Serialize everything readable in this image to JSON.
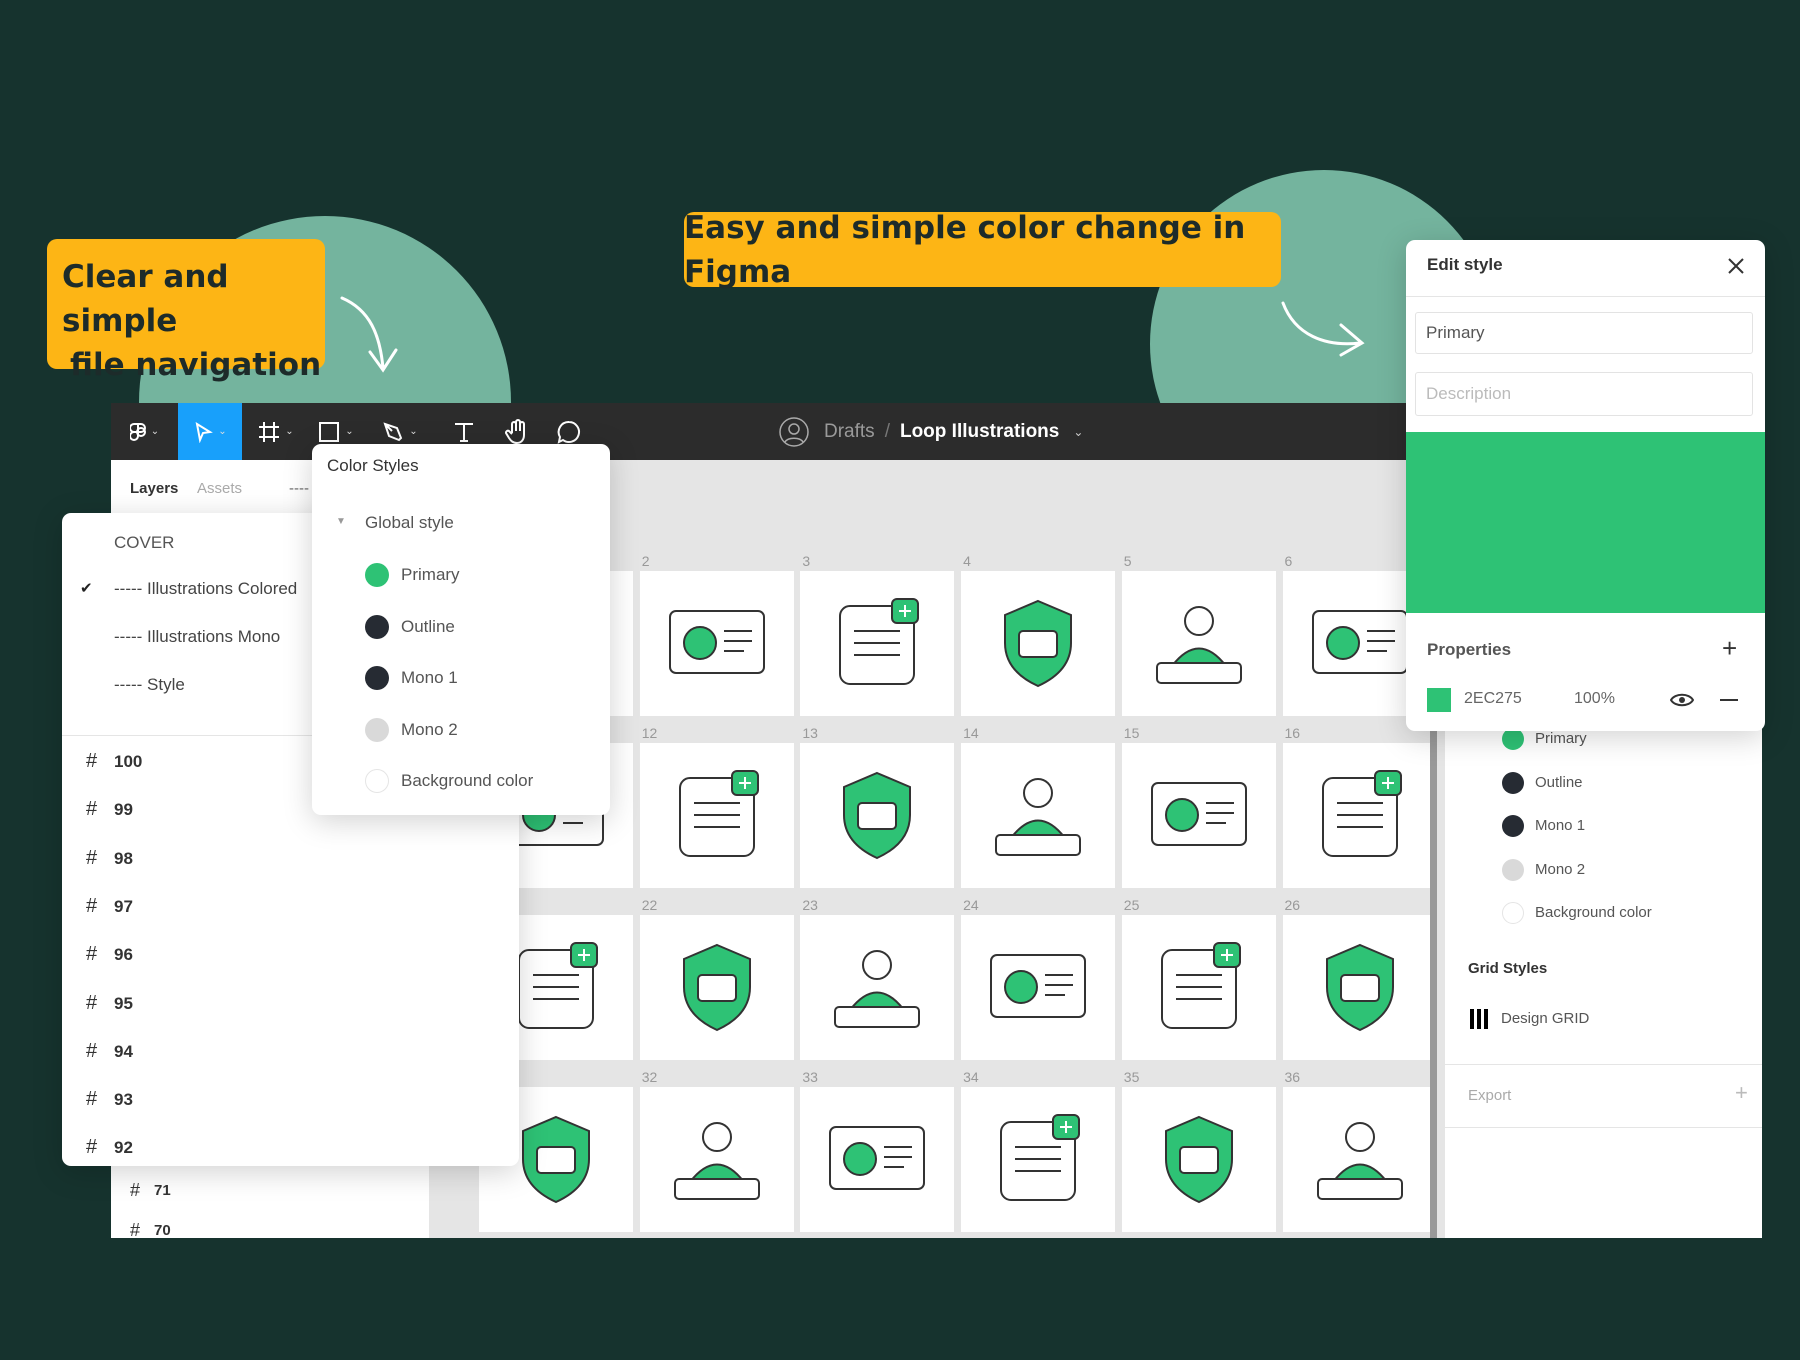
{
  "callouts": {
    "left_line1": "Clear and simple",
    "left_line2": "file navigation",
    "center": "Easy and simple color change in Figma"
  },
  "colors": {
    "background": "#16332e",
    "circle": "#74b49e",
    "callout": "#fdb515",
    "accent": "#2EC275",
    "select_blue": "#18a0fb",
    "toolbar": "#2c2c2c"
  },
  "toolbar": {
    "tools": [
      "figma-menu-icon",
      "move-icon",
      "frame-icon",
      "rectangle-icon",
      "pen-icon",
      "text-icon",
      "hand-icon",
      "comment-icon"
    ],
    "breadcrumb_parent": "Drafts",
    "separator": "/",
    "file_name": "Loop Illustrations"
  },
  "left_panel": {
    "tab_layers": "Layers",
    "tab_assets": "Assets",
    "tab_more": "----",
    "extra_frames": [
      "71",
      "70"
    ]
  },
  "pages_popup": {
    "cover": "COVER",
    "pages": [
      "----- Illustrations Colored",
      "----- Illustrations Mono",
      "----- Style"
    ],
    "selected_index": 0,
    "frames": [
      "100",
      "99",
      "98",
      "97",
      "96",
      "95",
      "94",
      "93",
      "92"
    ]
  },
  "color_styles": {
    "title": "Color Styles",
    "group": "Global style",
    "styles": [
      {
        "name": "Primary",
        "color": "#2EC275"
      },
      {
        "name": "Outline",
        "color": "#262b33"
      },
      {
        "name": "Mono 1",
        "color": "#262b33"
      },
      {
        "name": "Mono 2",
        "color": "#d9d9d9"
      },
      {
        "name": "Background color",
        "color": "#ffffff"
      }
    ]
  },
  "canvas": {
    "rows": [
      [
        "",
        "2",
        "3",
        "4",
        "5",
        "6"
      ],
      [
        "",
        "12",
        "13",
        "14",
        "15",
        "16"
      ],
      [
        "",
        "22",
        "23",
        "24",
        "25",
        "26"
      ],
      [
        "",
        "32",
        "33",
        "34",
        "35",
        "36"
      ]
    ]
  },
  "right_panel": {
    "styles": [
      "Primary",
      "Outline",
      "Mono 1",
      "Mono 2",
      "Background color"
    ],
    "grid_title": "Grid Styles",
    "grid_item": "Design GRID",
    "export": "Export"
  },
  "edit_style": {
    "title": "Edit style",
    "name_value": "Primary",
    "description_placeholder": "Description",
    "color": "#2EC275",
    "properties_title": "Properties",
    "hex": "2EC275",
    "opacity": "100%"
  }
}
